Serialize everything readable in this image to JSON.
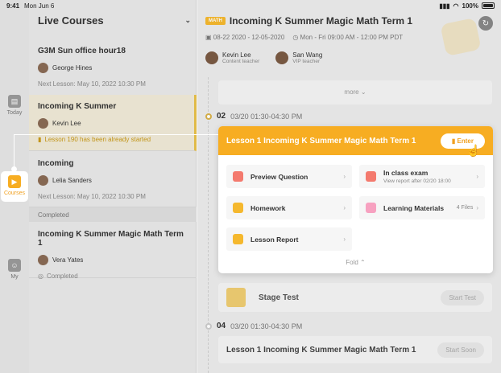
{
  "status_bar": {
    "time": "9:41",
    "date": "Mon Jun 6",
    "battery": "100%"
  },
  "rail": {
    "today": "Today",
    "courses": "Courses",
    "my": "My"
  },
  "list": {
    "header": "Live Courses",
    "courses": [
      {
        "title": "G3M Sun office hour18",
        "teacher": "George Hines",
        "meta": "Next Lesson: May 10, 2022  10:30 PM"
      },
      {
        "title": "Incoming K Summer",
        "teacher": "Kevin Lee",
        "meta": "Lesson 190 has been already started"
      },
      {
        "title": "Incoming",
        "teacher": "Lelia Sanders",
        "meta": "Next Lesson: May 10, 2022  10:30 PM"
      }
    ],
    "completed_label": "Completed",
    "completed_courses": [
      {
        "title": "Incoming K Summer Magic Math Term 1",
        "teacher": "Vera Yates",
        "meta": "Completed"
      }
    ]
  },
  "main": {
    "tag": "MATH",
    "title": "Incoming K Summer Magic Math Term 1",
    "date_range": "08-22 2020 - 12-05-2020",
    "schedule": "Mon - Fri 09:00 AM - 12:00 PM PDT",
    "teachers": [
      {
        "name": "Kevin Lee",
        "role": "Content teacher"
      },
      {
        "name": "San Wang",
        "role": "VIP teacher"
      }
    ],
    "more": "more",
    "lesson2": {
      "num": "02",
      "when": "03/20  01:30-04:30 PM"
    },
    "stage_test": {
      "title": "Stage Test",
      "button": "Start Test"
    },
    "lesson4": {
      "num": "04",
      "when": "03/20  01:30-04:30 PM"
    },
    "lesson4_card": {
      "title": "Lesson 1  Incoming K Summer Magic Math Term 1",
      "button": "Start Soon"
    }
  },
  "expanded": {
    "title": "Lesson 1  Incoming K Summer Magic Math Term 1",
    "enter": "Enter",
    "tiles": {
      "preview": "Preview Question",
      "exam": "In class exam",
      "exam_sub": "View report after 02/20 18:00",
      "homework": "Homework",
      "materials": "Learning Materials",
      "materials_count": "4 Files",
      "report": "Lesson Report"
    },
    "fold": "Fold"
  },
  "colors": {
    "accent": "#f7ad22",
    "background": "#ececec"
  }
}
